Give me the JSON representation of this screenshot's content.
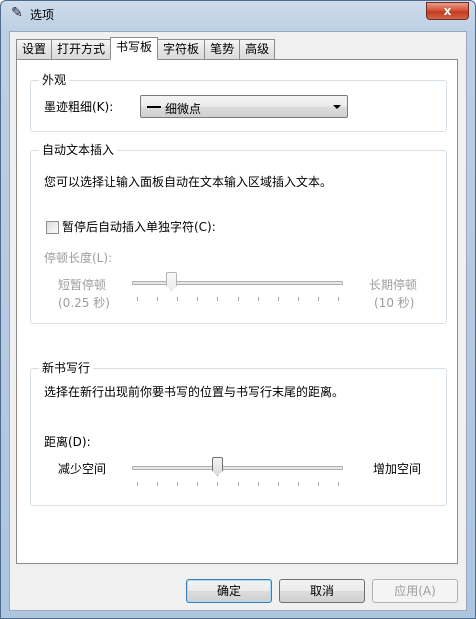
{
  "window": {
    "title": "选项",
    "close_glyph": "x"
  },
  "tabs": [
    {
      "label": "设置"
    },
    {
      "label": "打开方式"
    },
    {
      "label": "书写板",
      "active": true
    },
    {
      "label": "字符板"
    },
    {
      "label": "笔势"
    },
    {
      "label": "高级"
    }
  ],
  "appearance": {
    "title": "外观",
    "ink_label": "墨迹粗细(K):",
    "ink_value": "细微点"
  },
  "auto_insert": {
    "title": "自动文本插入",
    "description": "您可以选择让输入面板自动在文本输入区域插入文本。",
    "checkbox_label": "暂停后自动插入单独字符(C):",
    "checkbox_checked": false,
    "pause_length_label": "停顿长度(L):",
    "min_label": "短暂停顿",
    "min_sub": "(0.25 秒)",
    "max_label": "长期停顿",
    "max_sub": "(10 秒)",
    "slider_value_fraction": 0.17,
    "tick_count": 11
  },
  "new_line": {
    "title": "新书写行",
    "description": "选择在新行出现前你要书写的位置与书写行末尾的距离。",
    "distance_label": "距离(D):",
    "min_label": "减少空间",
    "max_label": "增加空间",
    "slider_value_fraction": 0.4,
    "tick_count": 11
  },
  "buttons": {
    "ok": "确定",
    "cancel": "取消",
    "apply": "应用(A)"
  },
  "icons": {
    "title_icon": "pen-options-icon"
  },
  "colors": {
    "title_bar": "#bccfe4",
    "close_button": "#c43a1f",
    "default_button_border": "#3c7fb1"
  }
}
